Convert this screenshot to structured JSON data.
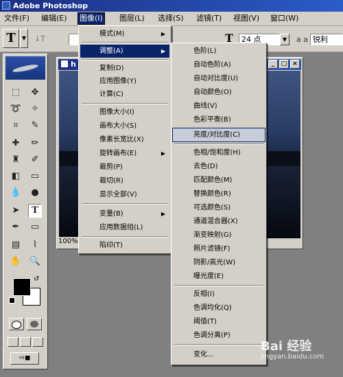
{
  "app": {
    "title": "Adobe Photoshop"
  },
  "menubar": {
    "items": [
      {
        "label": "文件(F)"
      },
      {
        "label": "编辑(E)"
      },
      {
        "label": "图像(I)"
      },
      {
        "label": "图层(L)"
      },
      {
        "label": "选择(S)"
      },
      {
        "label": "滤镜(T)"
      },
      {
        "label": "视图(V)"
      },
      {
        "label": "窗口(W)"
      }
    ]
  },
  "options_bar": {
    "tool_glyph": "T",
    "font_size": "24 点",
    "aa_label": "a a",
    "aa_value": "锐利"
  },
  "document": {
    "title": "h",
    "zoom": "100%"
  },
  "image_menu": {
    "items": [
      {
        "label": "模式(M)",
        "submenu": true
      },
      {
        "label": "调整(A)",
        "submenu": true
      },
      {
        "label": "复制(D)"
      },
      {
        "label": "应用图像(Y)"
      },
      {
        "label": "计算(C)"
      },
      {
        "label": "图像大小(I)"
      },
      {
        "label": "画布大小(S)"
      },
      {
        "label": "像素长宽比(X)"
      },
      {
        "label": "旋转画布(E)",
        "submenu": true
      },
      {
        "label": "裁剪(P)"
      },
      {
        "label": "裁切(R)"
      },
      {
        "label": "显示全部(V)"
      },
      {
        "label": "变量(B)",
        "submenu": true
      },
      {
        "label": "应用数据组(L)"
      },
      {
        "label": "陷印(T)"
      }
    ]
  },
  "adjust_menu": {
    "items": [
      {
        "label": "色阶(L)"
      },
      {
        "label": "自动色阶(A)"
      },
      {
        "label": "自动对比度(U)"
      },
      {
        "label": "自动颜色(O)"
      },
      {
        "label": "曲线(V)"
      },
      {
        "label": "色彩平衡(B)"
      },
      {
        "label": "亮度/对比度(C)"
      },
      {
        "label": "色相/饱和度(H)"
      },
      {
        "label": "去色(D)"
      },
      {
        "label": "匹配颜色(M)"
      },
      {
        "label": "替换颜色(R)"
      },
      {
        "label": "可选颜色(S)"
      },
      {
        "label": "通道混合器(X)"
      },
      {
        "label": "渐变映射(G)"
      },
      {
        "label": "照片滤镜(F)"
      },
      {
        "label": "阴影/高光(W)"
      },
      {
        "label": "曝光度(E)"
      },
      {
        "label": "反相(I)"
      },
      {
        "label": "色调均化(Q)"
      },
      {
        "label": "阈值(T)"
      },
      {
        "label": "色调分离(P)"
      },
      {
        "label": "变化..."
      }
    ]
  },
  "watermark": {
    "brand": "Bai 经验",
    "url": "jingyan.baidu.com"
  }
}
